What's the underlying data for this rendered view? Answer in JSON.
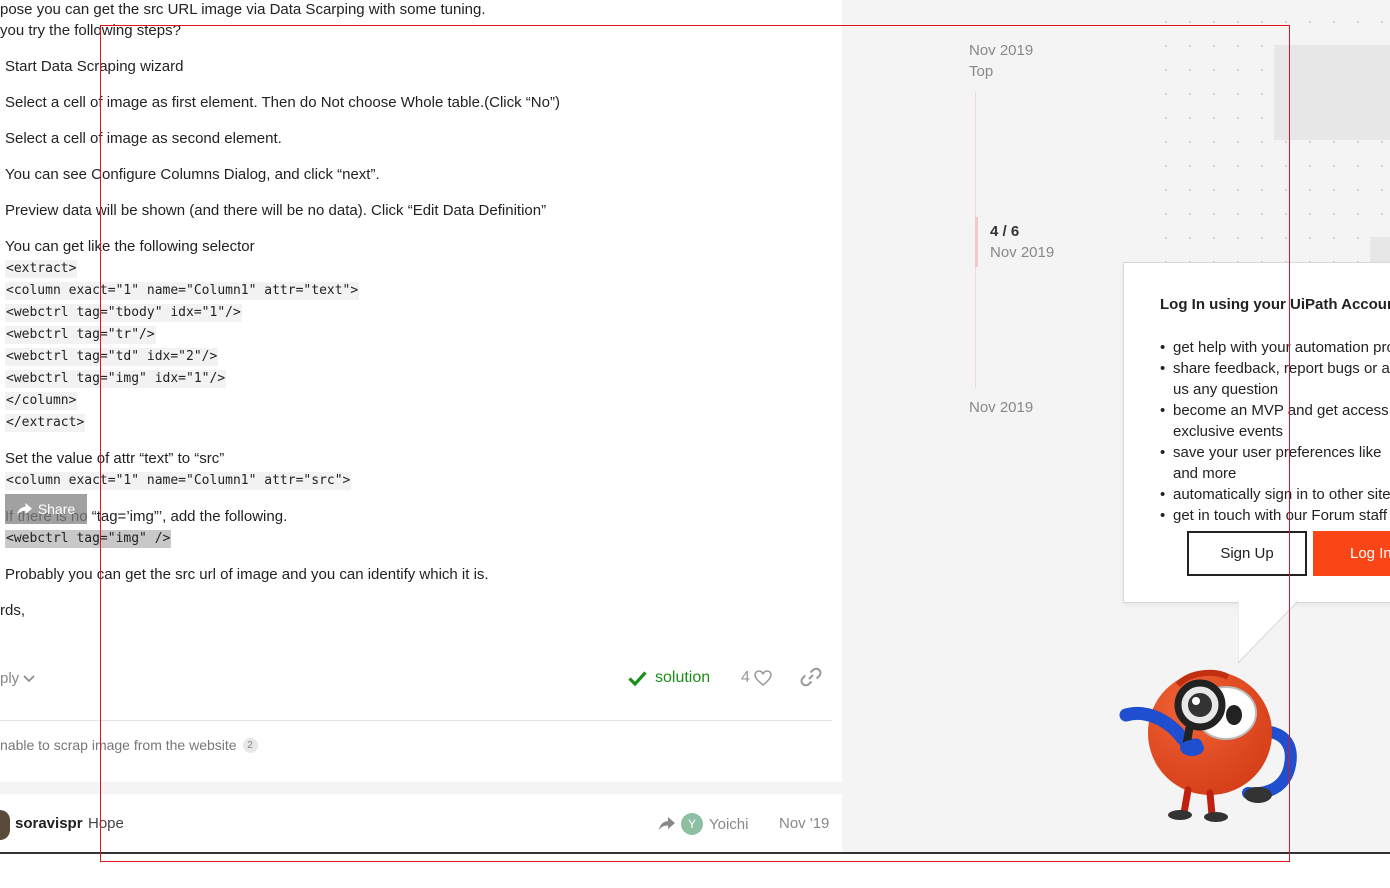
{
  "post": {
    "intro_line1": "pose you can get the src URL image via Data Scarping with some tuning.",
    "intro_line2": "you try the following steps?",
    "steps": [
      "Start Data Scraping wizard",
      "Select a cell of image as first element. Then do Not choose Whole table.(Click “No”)",
      "Select a cell of image as second element.",
      "You can see Configure Columns Dialog, and click “next”.",
      "Preview data will be shown (and there will be no data). Click “Edit Data Definition”",
      "You can get like the following selector"
    ],
    "selector_code": [
      "<extract>",
      "<column exact=\"1\" name=\"Column1\" attr=\"text\">",
      "<webctrl tag=\"tbody\" idx=\"1\"/>",
      "<webctrl tag=\"tr\"/>",
      "<webctrl tag=\"td\" idx=\"2\"/>",
      "<webctrl tag=\"img\" idx=\"1\"/>",
      "</column>",
      "</extract>"
    ],
    "step_set_attr": "Set the value of attr “text” to “src”",
    "code_src": "<column exact=\"1\" name=\"Column1\" attr=\"src\">",
    "step_no_tag": "If there is no “tag=’img”’, add the following.",
    "code_img": "<webctrl tag=\"img\" />",
    "step_result": "Probably you can get the src url of image and you can identify which it is.",
    "closing": "rds,"
  },
  "share_label": "Share",
  "controls": {
    "reply_label": "ply",
    "solution_label": "solution",
    "like_count": "4"
  },
  "linked_topic": {
    "title": "nable to scrap image from the website",
    "count": "2"
  },
  "reply_row": {
    "username": "soravispr",
    "snippet": "Hope",
    "reply_to_initial": "Y",
    "reply_to_name": "Yoichi",
    "date": "Nov '19"
  },
  "timeline": {
    "start_date": "Nov 2019",
    "top_label": "Top",
    "position": "4 / 6",
    "position_date": "Nov 2019",
    "end_date": "Nov 2019"
  },
  "login_popup": {
    "title": "Log In using your UiPath Account",
    "benefits": [
      "get help with your automation projects",
      "share feedback, report bugs or ask",
      "us any question",
      "become an MVP and get access to",
      "exclusive events",
      "save your user preferences like",
      "and more",
      "automatically sign in to other sites",
      "get in touch with our Forum staff"
    ],
    "signup_label": "Sign Up",
    "login_label": "Log In"
  },
  "colors": {
    "accent_orange": "#fa4616",
    "solution_green": "#1a8f1a",
    "frame_red": "#e0141e"
  }
}
